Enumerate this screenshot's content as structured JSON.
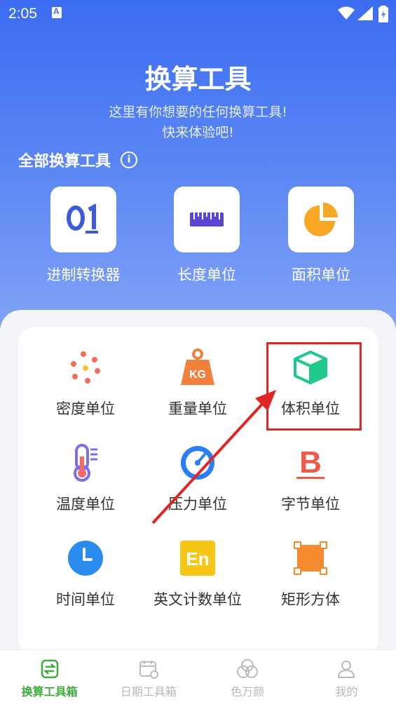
{
  "status": {
    "time": "2:05"
  },
  "header": {
    "title": "换算工具",
    "subtitle_line1": "这里有你想要的任何换算工具!",
    "subtitle_line2": "快来体验吧!"
  },
  "section": {
    "title": "全部换算工具"
  },
  "top_tools": [
    {
      "label": "进制转换器",
      "icon": "binary-01-icon"
    },
    {
      "label": "长度单位",
      "icon": "ruler-icon"
    },
    {
      "label": "面积单位",
      "icon": "pie-icon"
    }
  ],
  "grid_tools": [
    {
      "label": "密度单位",
      "icon": "dots-icon"
    },
    {
      "label": "重量单位",
      "icon": "kg-weight-icon",
      "icon_text": "KG"
    },
    {
      "label": "体积单位",
      "icon": "cube-icon"
    },
    {
      "label": "温度单位",
      "icon": "thermometer-icon"
    },
    {
      "label": "压力单位",
      "icon": "gauge-icon"
    },
    {
      "label": "字节单位",
      "icon": "bold-b-icon",
      "icon_text": "B"
    },
    {
      "label": "时间单位",
      "icon": "clock-icon"
    },
    {
      "label": "英文计数单位",
      "icon": "en-icon",
      "icon_text": "En"
    },
    {
      "label": "矩形方体",
      "icon": "rectangle-icon"
    }
  ],
  "tabs": [
    {
      "label": "换算工具箱",
      "active": true
    },
    {
      "label": "日期工具箱",
      "active": false
    },
    {
      "label": "色万颜",
      "active": false
    },
    {
      "label": "我的",
      "active": false
    }
  ],
  "colors": {
    "accent_green": "#3dac3b",
    "hero_blue": "#3c6cf2",
    "highlight_red": "#e02525"
  }
}
